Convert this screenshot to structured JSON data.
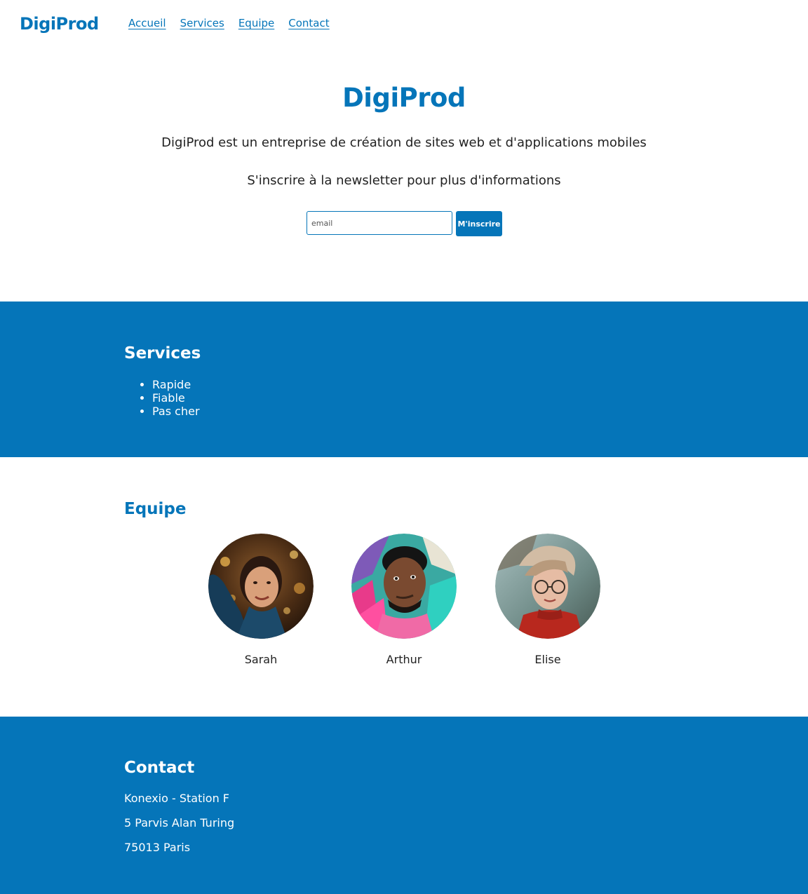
{
  "header": {
    "logo": "DigiProd",
    "nav": [
      "Accueil",
      "Services",
      "Equipe",
      "Contact"
    ]
  },
  "hero": {
    "title": "DigiProd",
    "description": "DigiProd est un entreprise de création de sites web et d'applications mobiles",
    "newsletter_text": "S'inscrire à la newsletter pour plus d'informations",
    "email_placeholder": "email",
    "email_value": "",
    "subscribe_label": "M'inscrire"
  },
  "services": {
    "title": "Services",
    "items": [
      "Rapide",
      "Fiable",
      "Pas cher"
    ]
  },
  "team": {
    "title": "Equipe",
    "members": [
      {
        "name": "Sarah"
      },
      {
        "name": "Arthur"
      },
      {
        "name": "Elise"
      }
    ]
  },
  "contact": {
    "title": "Contact",
    "lines": [
      "Konexio - Station F",
      "5 Parvis Alan Turing",
      "75013 Paris"
    ]
  },
  "colors": {
    "brand": "#0575b9",
    "text": "#222222",
    "background": "#ffffff"
  }
}
